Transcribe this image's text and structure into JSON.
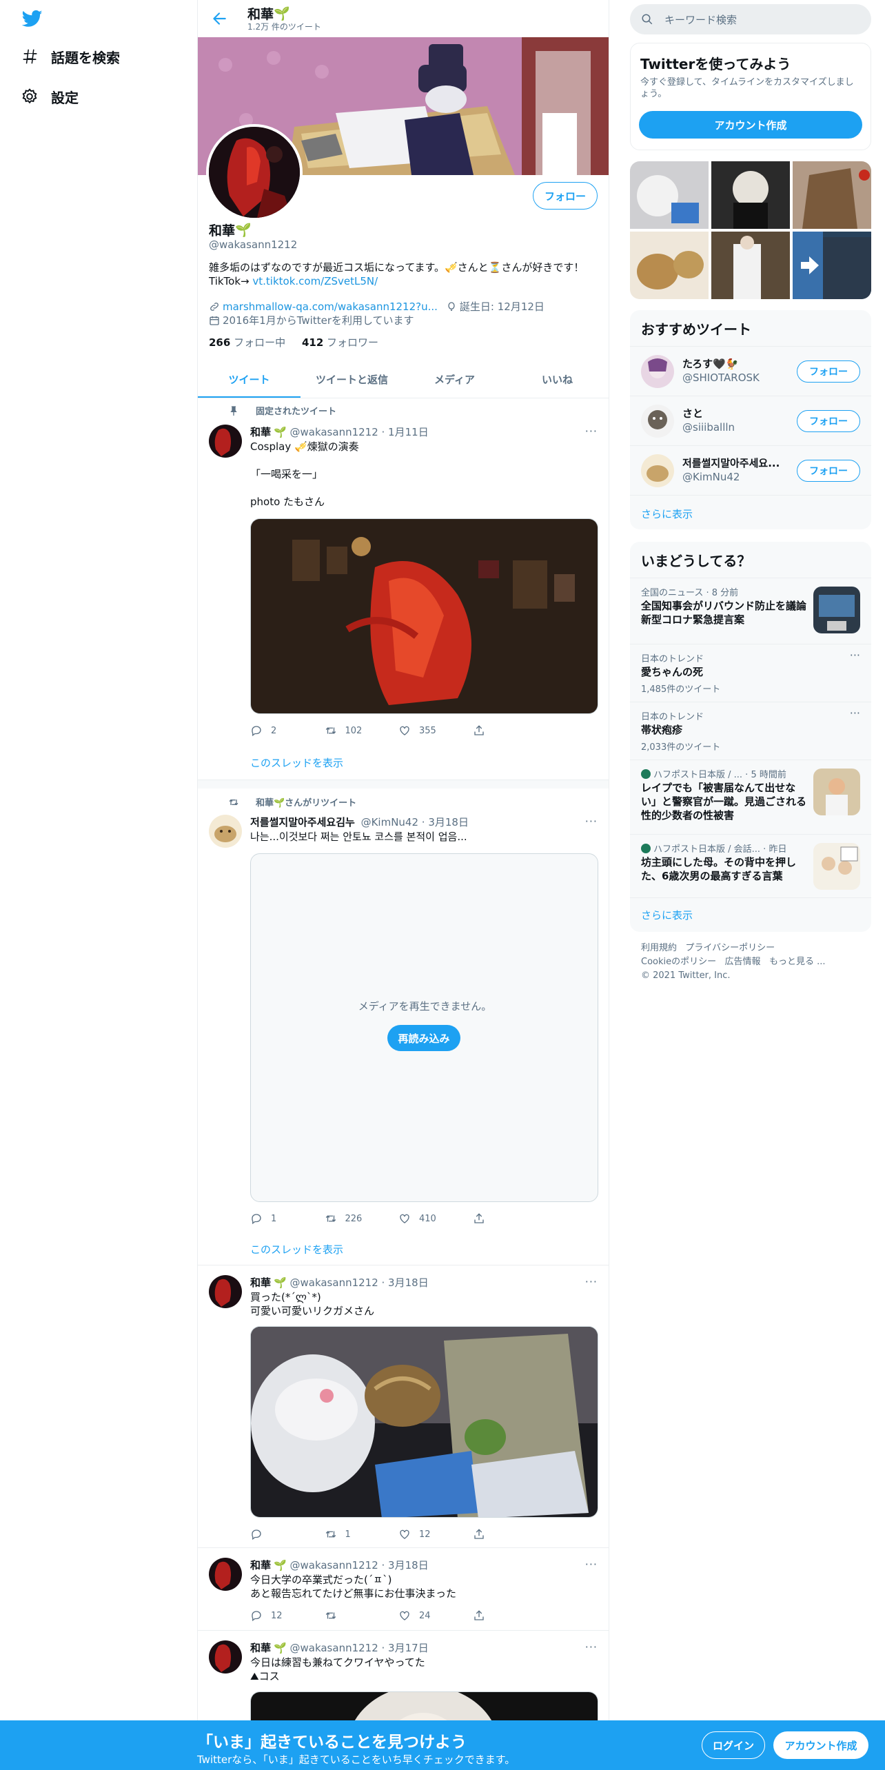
{
  "nav": {
    "explore_label": "話題を検索",
    "settings_label": "設定"
  },
  "header": {
    "title": "和華",
    "tweet_count": "1.2万 件のツイート"
  },
  "profile": {
    "name": "和華",
    "handle": "@wakasann1212",
    "follow_label": "フォロー",
    "bio_line1": "雑多垢のはずなのですが最近コス垢になってます。🎺さんと⏳さんが好きです！",
    "bio_line2_prefix": "TikTok→ ",
    "bio_link": "vt.tiktok.com/ZSvetL5N/",
    "website": "marshmallow-qa.com/wakasann1212?u...",
    "birthday": "誕生日: 12月12日",
    "joined": "2016年1月からTwitterを利用しています",
    "following_count": "266",
    "following_label": "フォロー中",
    "followers_count": "412",
    "followers_label": "フォロワー"
  },
  "tabs": [
    {
      "label": "ツイート"
    },
    {
      "label": "ツイートと返信"
    },
    {
      "label": "メディア"
    },
    {
      "label": "いいね"
    }
  ],
  "tweets": [
    {
      "context": "固定されたツイート",
      "name": "和華",
      "meta": "@wakasann1212 · 1月11日",
      "text": "Cosplay 🎺煉獄の演奏\n\n「一喝采を一」\n\nphoto たもさん",
      "reply": "2",
      "retweet": "102",
      "like": "355",
      "show_thread": "このスレッドを表示"
    },
    {
      "context": "和華🌱さんがリツイート",
      "name": "저를썰지말아주세요김누",
      "meta": "@KimNu42 · 3月18日",
      "text": "나는...이것보다 쩌는 안토뇨 코스를 본적이 업음...",
      "media_error": "メディアを再生できません。",
      "reload_label": "再読み込み",
      "reply": "1",
      "retweet": "226",
      "like": "410",
      "show_thread": "このスレッドを表示"
    },
    {
      "name": "和華",
      "meta": "@wakasann1212 · 3月18日",
      "text": "買った(*´ლ`*)\n可愛い可愛いリクガメさん",
      "reply": "",
      "retweet": "1",
      "like": "12"
    },
    {
      "name": "和華",
      "meta": "@wakasann1212 · 3月18日",
      "text": "今日大学の卒業式だった(´ㅍ`)\nあと報告忘れてたけど無事にお仕事決まった",
      "reply": "12",
      "retweet": "",
      "like": "24"
    },
    {
      "name": "和華",
      "meta": "@wakasann1212 · 3月17日",
      "text": "今日は練習も兼ねてクワイヤやってた\n⛰コス"
    }
  ],
  "search": {
    "placeholder": "キーワード検索"
  },
  "signup_card": {
    "title": "Twitterを使ってみよう",
    "subtitle": "今すぐ登録して、タイムラインをカスタマイズしましょう。",
    "button": "アカウント作成"
  },
  "recommended": {
    "title": "おすすめツイート",
    "users": [
      {
        "name": "たろす🖤🐓",
        "handle": "@SHIOTAROSK",
        "button": "フォロー"
      },
      {
        "name": "さと",
        "handle": "@siiiballln",
        "button": "フォロー"
      },
      {
        "name": "저를썰지말아주세요...",
        "handle": "@KimNu42",
        "button": "フォロー"
      }
    ],
    "show_more": "さらに表示"
  },
  "trends": {
    "title": "いまどうしてる？",
    "items": [
      {
        "meta": "全国のニュース · 8 分前",
        "title": "全国知事会がリバウンド防止を議論 新型コロナ緊急提言案"
      },
      {
        "meta": "日本のトレンド",
        "title": "愛ちゃんの死",
        "count": "1,485件のツイート"
      },
      {
        "meta": "日本のトレンド",
        "title": "帯状疱疹",
        "count": "2,033件のツイート"
      },
      {
        "meta": "ハフポスト日本版 / ... · 5 時間前",
        "title": "レイプでも「被害届なんて出せない」と警察官が一蹴。見過ごされる性的少数者の性被害"
      },
      {
        "meta": "ハフポスト日本版 / 会話... · 昨日",
        "title": "坊主頭にした母。その背中を押した、6歳次男の最高すぎる言葉"
      }
    ],
    "show_more": "さらに表示"
  },
  "footer": {
    "terms": "利用規約",
    "privacy": "プライバシーポリシー",
    "cookie": "Cookieのポリシー",
    "ads": "広告情報",
    "more": "もっと見る ...",
    "copyright": "© 2021 Twitter, Inc."
  },
  "bottom_bar": {
    "title": "「いま」起きていることを見つけよう",
    "subtitle": "Twitterなら、「いま」起きていることをいち早くチェックできます。",
    "login": "ログイン",
    "signup": "アカウント作成"
  },
  "colors": {
    "accent": "#1da1f2",
    "text": "#0f1419",
    "secondary": "#5b7083"
  }
}
